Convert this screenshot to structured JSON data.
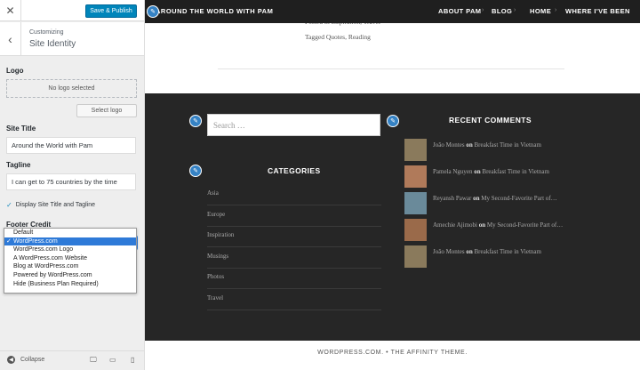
{
  "sidebar": {
    "publish_label": "Save & Publish",
    "customizing_label": "Customizing",
    "section_title": "Site Identity",
    "logo_label": "Logo",
    "no_logo_text": "No logo selected",
    "select_logo_label": "Select logo",
    "site_title_label": "Site Title",
    "site_title_value": "Around the World with Pam",
    "tagline_label": "Tagline",
    "tagline_value": "I can get to 75 countries by the time",
    "display_checkbox_label": "Display Site Title and Tagline",
    "footer_credit_label": "Footer Credit",
    "footer_credit_options": [
      "Default",
      "WordPress.com",
      "WordPress.com Logo",
      "A WordPress.com Website",
      "Blog at WordPress.com",
      "Powered by WordPress.com",
      "Hide (Business Plan Required)"
    ],
    "footer_credit_selected": "WordPress.com",
    "collapse_label": "Collapse",
    "devices": [
      "desktop-icon",
      "tablet-icon",
      "mobile-icon"
    ]
  },
  "preview": {
    "site_title": "AROUND THE WORLD WITH PAM",
    "nav_items": [
      "ABOUT PAM",
      "BLOG",
      "HOME",
      "WHERE I'VE BEEN"
    ],
    "posted_in_text": "Posted in Inspiration, Travel",
    "tagged_prefix": "Tagged ",
    "tags": [
      "Quotes",
      "Reading"
    ],
    "search_placeholder": "Search …",
    "categories_title": "CATEGORIES",
    "categories": [
      "Asia",
      "Europe",
      "Inspiration",
      "Musings",
      "Photos",
      "Travel"
    ],
    "recent_comments_title": "RECENT COMMENTS",
    "comments": [
      {
        "author": "João Montes",
        "on": "on",
        "post": "Breakfast Time in Vietnam"
      },
      {
        "author": "Pamela Nguyen",
        "on": "on",
        "post": "Breakfast Time in Vietnam"
      },
      {
        "author": "Reyansh Pawar",
        "on": "on",
        "post": "My Second-Favorite Part of…"
      },
      {
        "author": "Amechie Ajimobi",
        "on": "on",
        "post": "My Second-Favorite Part of…"
      },
      {
        "author": "João Montes",
        "on": "on",
        "post": "Breakfast Time in Vietnam"
      }
    ],
    "footer_credit": "WORDPRESS.COM.  •  THE AFFINITY THEME."
  },
  "colors": {
    "accent": "#0085ba",
    "dark_bg": "#262626",
    "nav_bg": "#1f1f1f",
    "edit_icon": "#3582c4"
  }
}
